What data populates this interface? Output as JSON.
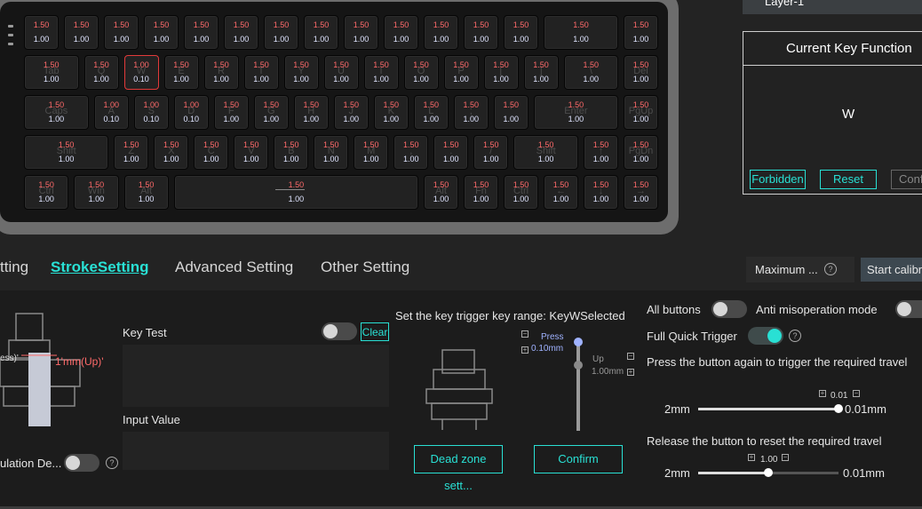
{
  "keyboard": {
    "rows": [
      [
        {
          "top": "1.50",
          "bottom": "1.00"
        },
        {
          "top": "1.50",
          "bottom": "1.00"
        },
        {
          "top": "1.50",
          "bottom": "1.00"
        },
        {
          "top": "1.50",
          "bottom": "1.00"
        },
        {
          "top": "1.50",
          "bottom": "1.00"
        },
        {
          "top": "1.50",
          "bottom": "1.00"
        },
        {
          "top": "1.50",
          "bottom": "1.00"
        },
        {
          "top": "1.50",
          "bottom": "1.00"
        },
        {
          "top": "1.50",
          "bottom": "1.00"
        },
        {
          "top": "1.50",
          "bottom": "1.00"
        },
        {
          "top": "1.50",
          "bottom": "1.00"
        },
        {
          "top": "1.50",
          "bottom": "1.00"
        },
        {
          "top": "1.50",
          "bottom": "1.00"
        },
        {
          "top": "1.50",
          "bottom": "1.00"
        },
        {
          "top": "1.50",
          "bottom": "1.00"
        }
      ],
      [
        {
          "top": "1.50",
          "bottom": "1.00",
          "label": "Tab"
        },
        {
          "top": "1.50",
          "bottom": "1.00",
          "label": "Q"
        },
        {
          "top": "1.00",
          "bottom": "0.10",
          "label": "W",
          "selected": true
        },
        {
          "top": "1.50",
          "bottom": "1.00",
          "label": "E"
        },
        {
          "top": "1.50",
          "bottom": "1.00",
          "label": "R"
        },
        {
          "top": "1.50",
          "bottom": "1.00",
          "label": "T"
        },
        {
          "top": "1.50",
          "bottom": "1.00",
          "label": "Y"
        },
        {
          "top": "1.50",
          "bottom": "1.00",
          "label": "U"
        },
        {
          "top": "1.50",
          "bottom": "1.00",
          "label": "I"
        },
        {
          "top": "1.50",
          "bottom": "1.00",
          "label": "O"
        },
        {
          "top": "1.50",
          "bottom": "1.00",
          "label": "P"
        },
        {
          "top": "1.50",
          "bottom": "1.00",
          "label": "["
        },
        {
          "top": "1.50",
          "bottom": "1.00",
          "label": "]"
        },
        {
          "top": "1.50",
          "bottom": "1.00",
          "label": "\\"
        },
        {
          "top": "1.50",
          "bottom": "1.00",
          "label": "Del"
        }
      ],
      [
        {
          "top": "1.50",
          "bottom": "1.00",
          "label": "Caps"
        },
        {
          "top": "1.00",
          "bottom": "0.10",
          "label": "A"
        },
        {
          "top": "1.00",
          "bottom": "0.10",
          "label": "S"
        },
        {
          "top": "1.00",
          "bottom": "0.10",
          "label": "D"
        },
        {
          "top": "1.50",
          "bottom": "1.00",
          "label": "F"
        },
        {
          "top": "1.50",
          "bottom": "1.00",
          "label": "G"
        },
        {
          "top": "1.50",
          "bottom": "1.00",
          "label": "H"
        },
        {
          "top": "1.50",
          "bottom": "1.00",
          "label": "J"
        },
        {
          "top": "1.50",
          "bottom": "1.00",
          "label": "K"
        },
        {
          "top": "1.50",
          "bottom": "1.00",
          "label": "L"
        },
        {
          "top": "1.50",
          "bottom": "1.00",
          "label": ";"
        },
        {
          "top": "1.50",
          "bottom": "1.00",
          "label": "'"
        },
        {
          "top": "1.50",
          "bottom": "1.00",
          "label": "Enter"
        },
        {
          "top": "1.50",
          "bottom": "1.00",
          "label": "PgUp"
        }
      ],
      [
        {
          "top": "1.50",
          "bottom": "1.00",
          "label": "Shift"
        },
        {
          "top": "1.50",
          "bottom": "1.00",
          "label": "Z"
        },
        {
          "top": "1.50",
          "bottom": "1.00",
          "label": "X"
        },
        {
          "top": "1.50",
          "bottom": "1.00",
          "label": "C"
        },
        {
          "top": "1.50",
          "bottom": "1.00",
          "label": "V"
        },
        {
          "top": "1.50",
          "bottom": "1.00",
          "label": "B"
        },
        {
          "top": "1.50",
          "bottom": "1.00",
          "label": "N"
        },
        {
          "top": "1.50",
          "bottom": "1.00",
          "label": "M"
        },
        {
          "top": "1.50",
          "bottom": "1.00",
          "label": ","
        },
        {
          "top": "1.50",
          "bottom": "1.00",
          "label": "."
        },
        {
          "top": "1.50",
          "bottom": "1.00",
          "label": "/"
        },
        {
          "top": "1.50",
          "bottom": "1.00",
          "label": "Shift"
        },
        {
          "top": "1.50",
          "bottom": "1.00",
          "label": "↑"
        },
        {
          "top": "1.50",
          "bottom": "1.00",
          "label": "PgDn"
        }
      ],
      [
        {
          "top": "1.50",
          "bottom": "1.00",
          "label": "Ctrl"
        },
        {
          "top": "1.50",
          "bottom": "1.00",
          "label": "Win"
        },
        {
          "top": "1.50",
          "bottom": "1.00",
          "label": "Alt"
        },
        {
          "top": "1.50",
          "bottom": "1.00",
          "label": ""
        },
        {
          "top": "1.50",
          "bottom": "1.00",
          "label": "Alt"
        },
        {
          "top": "1.50",
          "bottom": "1.00",
          "label": "Fn"
        },
        {
          "top": "1.50",
          "bottom": "1.00",
          "label": "Ctrl"
        },
        {
          "top": "1.50",
          "bottom": "1.00",
          "label": "←"
        },
        {
          "top": "1.50",
          "bottom": "1.00",
          "label": "↓"
        },
        {
          "top": "1.50",
          "bottom": "1.00",
          "label": "→"
        }
      ]
    ]
  },
  "layer": {
    "label": "Layer-1"
  },
  "current_key": {
    "title": "Current Key Function",
    "value": "W",
    "forbidden": "Forbidden",
    "reset": "Reset",
    "confirm": "Conf"
  },
  "tabs": [
    {
      "label": "tting"
    },
    {
      "label": "StrokeSetting",
      "active": true
    },
    {
      "label": "Advanced Setting"
    },
    {
      "label": "Other Setting"
    }
  ],
  "top_right": {
    "maximum": "Maximum ...",
    "start_calibration": "Start calibra"
  },
  "left_panel": {
    "press_label": "ess)'",
    "up_label": "1'mm(Up)'",
    "simulation_label": "ulation De..."
  },
  "key_test": {
    "label": "Key Test",
    "clear": "Clear",
    "input_value": "Input Value"
  },
  "trigger": {
    "title": "Set the key trigger key range: KeyWSelected",
    "press": "Press",
    "press_value": "0.10mm",
    "up": "Up",
    "up_value": "1.00mm",
    "dead_zone": "Dead zone sett...",
    "confirm": "Confirm"
  },
  "settings": {
    "all_buttons": "All buttons",
    "anti_misoperation": "Anti misoperation mode",
    "full_quick_trigger": "Full Quick Trigger",
    "press_again": "Press the button again to trigger the required travel",
    "slider1": {
      "min": "2mm",
      "max": "0.01mm",
      "value": "0.01",
      "level": 1.0
    },
    "release": "Release the button to reset the required travel",
    "slider2": {
      "min": "2mm",
      "max": "0.01mm",
      "value": "1.00",
      "level": 0.5
    }
  },
  "colors": {
    "accent": "#29e0d4",
    "selected_key": "#e23a3a",
    "key_top_value": "#ff6a6a"
  }
}
